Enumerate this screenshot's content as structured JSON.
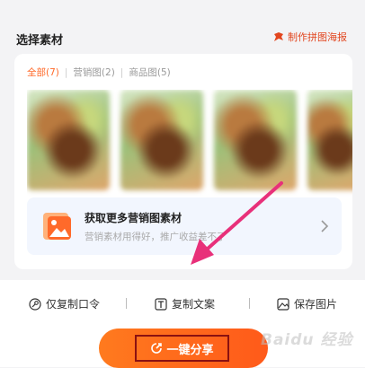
{
  "header": {
    "title": "选择素材",
    "make_collage_label": "制作拼图海报"
  },
  "filters": {
    "all": "全部(7)",
    "marketing": "营销图(2)",
    "product": "商品图(5)"
  },
  "promo": {
    "title": "获取更多营销图素材",
    "subtitle": "营销素材用得好，推广收益差不了"
  },
  "actions": {
    "copy_code": "仅复制口令",
    "copy_text": "复制文案",
    "save_image": "保存图片"
  },
  "share_button": {
    "label": "一键分享"
  },
  "watermark": "Baidu 经验",
  "colors": {
    "accent": "#ff6a2a",
    "annotation_arrow": "#e8307a",
    "annotation_box": "#8b1111"
  }
}
